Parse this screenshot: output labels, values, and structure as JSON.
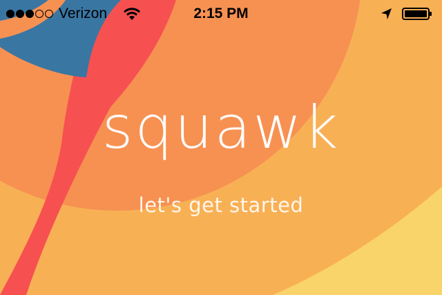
{
  "status_bar": {
    "carrier": "Verizon",
    "time": "2:15 PM",
    "signal_bars_filled": 3,
    "signal_bars_total": 5,
    "battery_level": 1.0,
    "icons": [
      "signal-dots-icon",
      "wifi-icon",
      "location-arrow-icon",
      "battery-icon"
    ]
  },
  "splash": {
    "app_name": "squawk",
    "call_to_action": "let's get started"
  },
  "colors": {
    "background_orange": "#f8b055",
    "outer_ring": "#f69152",
    "yellow_ring": "#f9d46a",
    "red_feather": "#f75050",
    "blue_feather": "#3a76a2",
    "text": "#ffffff"
  }
}
